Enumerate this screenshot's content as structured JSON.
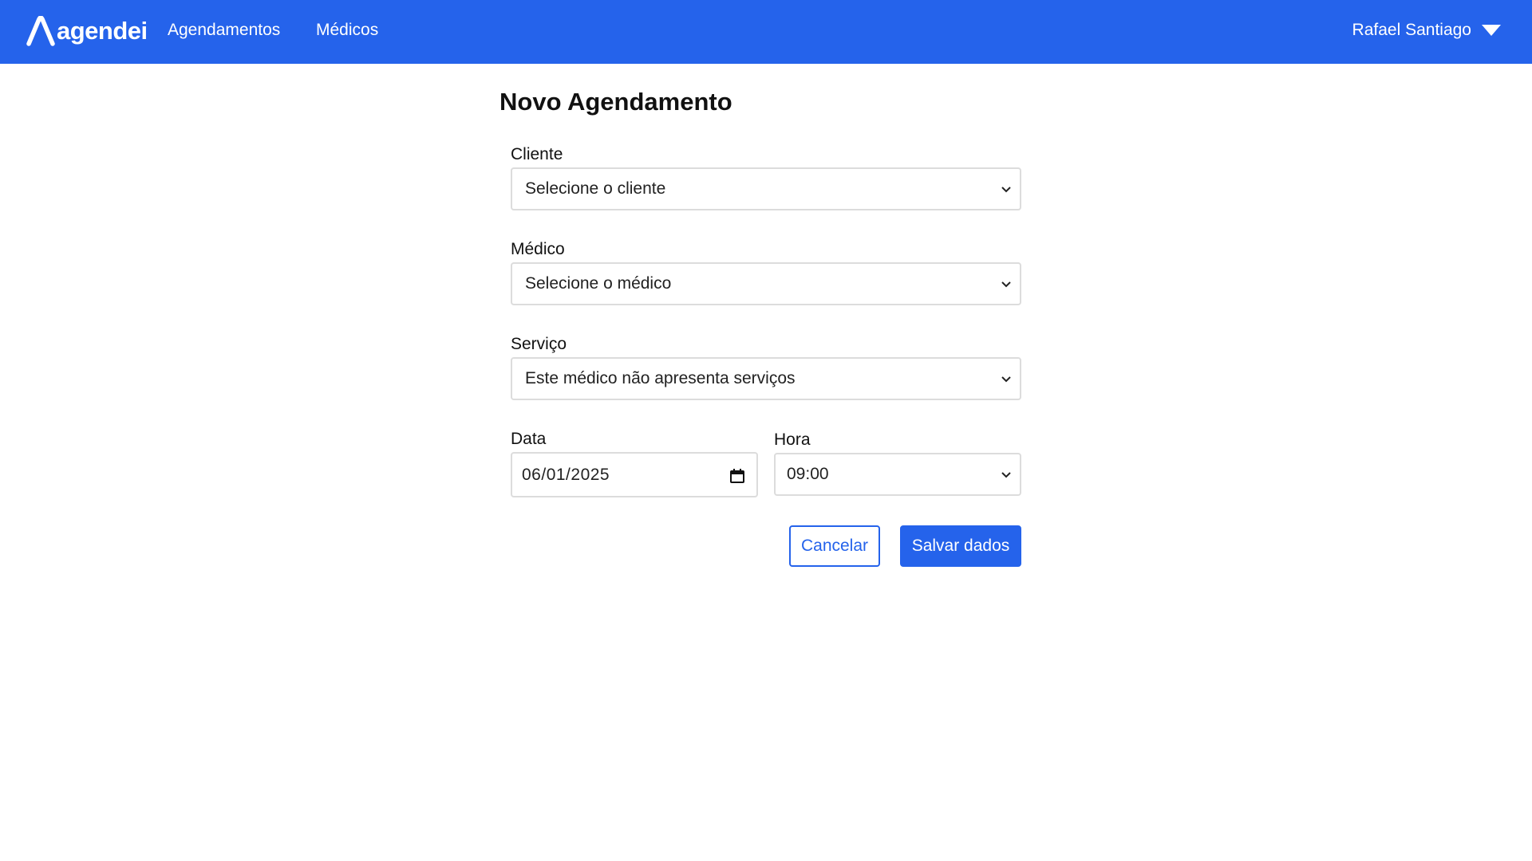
{
  "brand": {
    "name": "agendei",
    "color": "#2563eb"
  },
  "nav": {
    "links": [
      {
        "label": "Agendamentos"
      },
      {
        "label": "Médicos"
      }
    ],
    "user": {
      "name": "Rafael Santiago",
      "icon": "chevron-down-icon"
    }
  },
  "form": {
    "title": "Novo Agendamento",
    "cliente": {
      "label": "Cliente",
      "value": "Selecione o cliente"
    },
    "medico": {
      "label": "Médico",
      "value": "Selecione o médico"
    },
    "servico": {
      "label": "Serviço",
      "value": "Este médico não apresenta serviços"
    },
    "data": {
      "label": "Data",
      "value": "06/01/2025",
      "icon": "calendar-icon"
    },
    "hora": {
      "label": "Hora",
      "value": "09:00"
    },
    "cancel_label": "Cancelar",
    "save_label": "Salvar dados"
  }
}
